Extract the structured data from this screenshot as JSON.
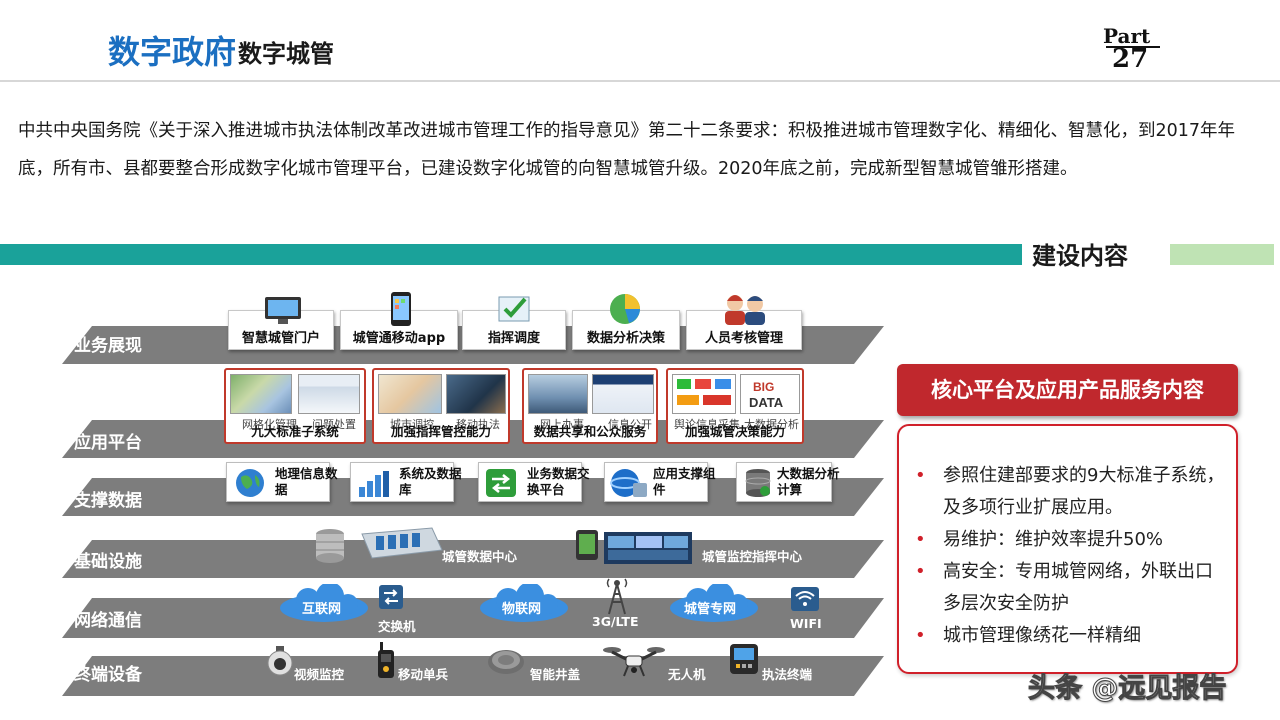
{
  "header": {
    "title_main": "数字政府",
    "title_sub": "数字城管",
    "part_label": "Part",
    "part_number": "27"
  },
  "intro_text": "中共中央国务院《关于深入推进城市执法体制改革改进城市管理工作的指导意见》第二十二条要求：积极推进城市管理数字化、精细化、智慧化，到2017年年底，所有市、县都要整合形成数字化城市管理平台，已建设数字化城管的向智慧城管升级。2020年底之前，完成新型智慧城管雏形搭建。",
  "section_title": "建设内容",
  "layers": {
    "business": {
      "label": "业务展现",
      "items": [
        "智慧城管门户",
        "城管通移动app",
        "指挥调度",
        "数据分析决策",
        "人员考核管理"
      ]
    },
    "application": {
      "label": "应用平台",
      "cards": [
        {
          "sub_left": "网格化管理",
          "sub_right": "问题处置",
          "main": "九大标准子系统"
        },
        {
          "sub_left": "城市调控",
          "sub_right": "移动执法",
          "main": "加强指挥管控能力"
        },
        {
          "sub_left": "网上办事",
          "sub_right": "信息公开",
          "main": "数据共享和公众服务"
        },
        {
          "sub_left": "舆论信息采集",
          "sub_right": "大数据分析",
          "main": "加强城管决策能力"
        }
      ]
    },
    "support": {
      "label": "支撑数据",
      "items": [
        "地理信息数据",
        "系统及数据库",
        "业务数据交换平台",
        "应用支撑组件",
        "大数据分析计算"
      ]
    },
    "infrastructure": {
      "label": "基础设施",
      "items": [
        "城管数据中心",
        "城管监控指挥中心"
      ]
    },
    "network": {
      "label": "网络通信",
      "items": [
        "互联网",
        "交换机",
        "物联网",
        "3G/LTE",
        "城管专网",
        "WIFI"
      ]
    },
    "terminal": {
      "label": "终端设备",
      "items": [
        "视频监控",
        "移动单兵",
        "智能井盖",
        "无人机",
        "执法终端"
      ]
    }
  },
  "core_panel": {
    "title": "核心平台及应用产品服务内容",
    "points": [
      "参照住建部要求的9大标准子系统，及多项行业扩展应用。",
      "易维护：维护效率提升50%",
      "高安全：专用城管网络，外联出口多层次安全防护",
      "城市管理像绣花一样精细"
    ]
  },
  "watermark": "头条 @远见报告",
  "colors": {
    "title_blue": "#1b6fc1",
    "teal_band": "#1aa29a",
    "light_green_band": "#bfe3b4",
    "red_accent": "#c0282d",
    "slab_gray": "#7d7d7d"
  }
}
